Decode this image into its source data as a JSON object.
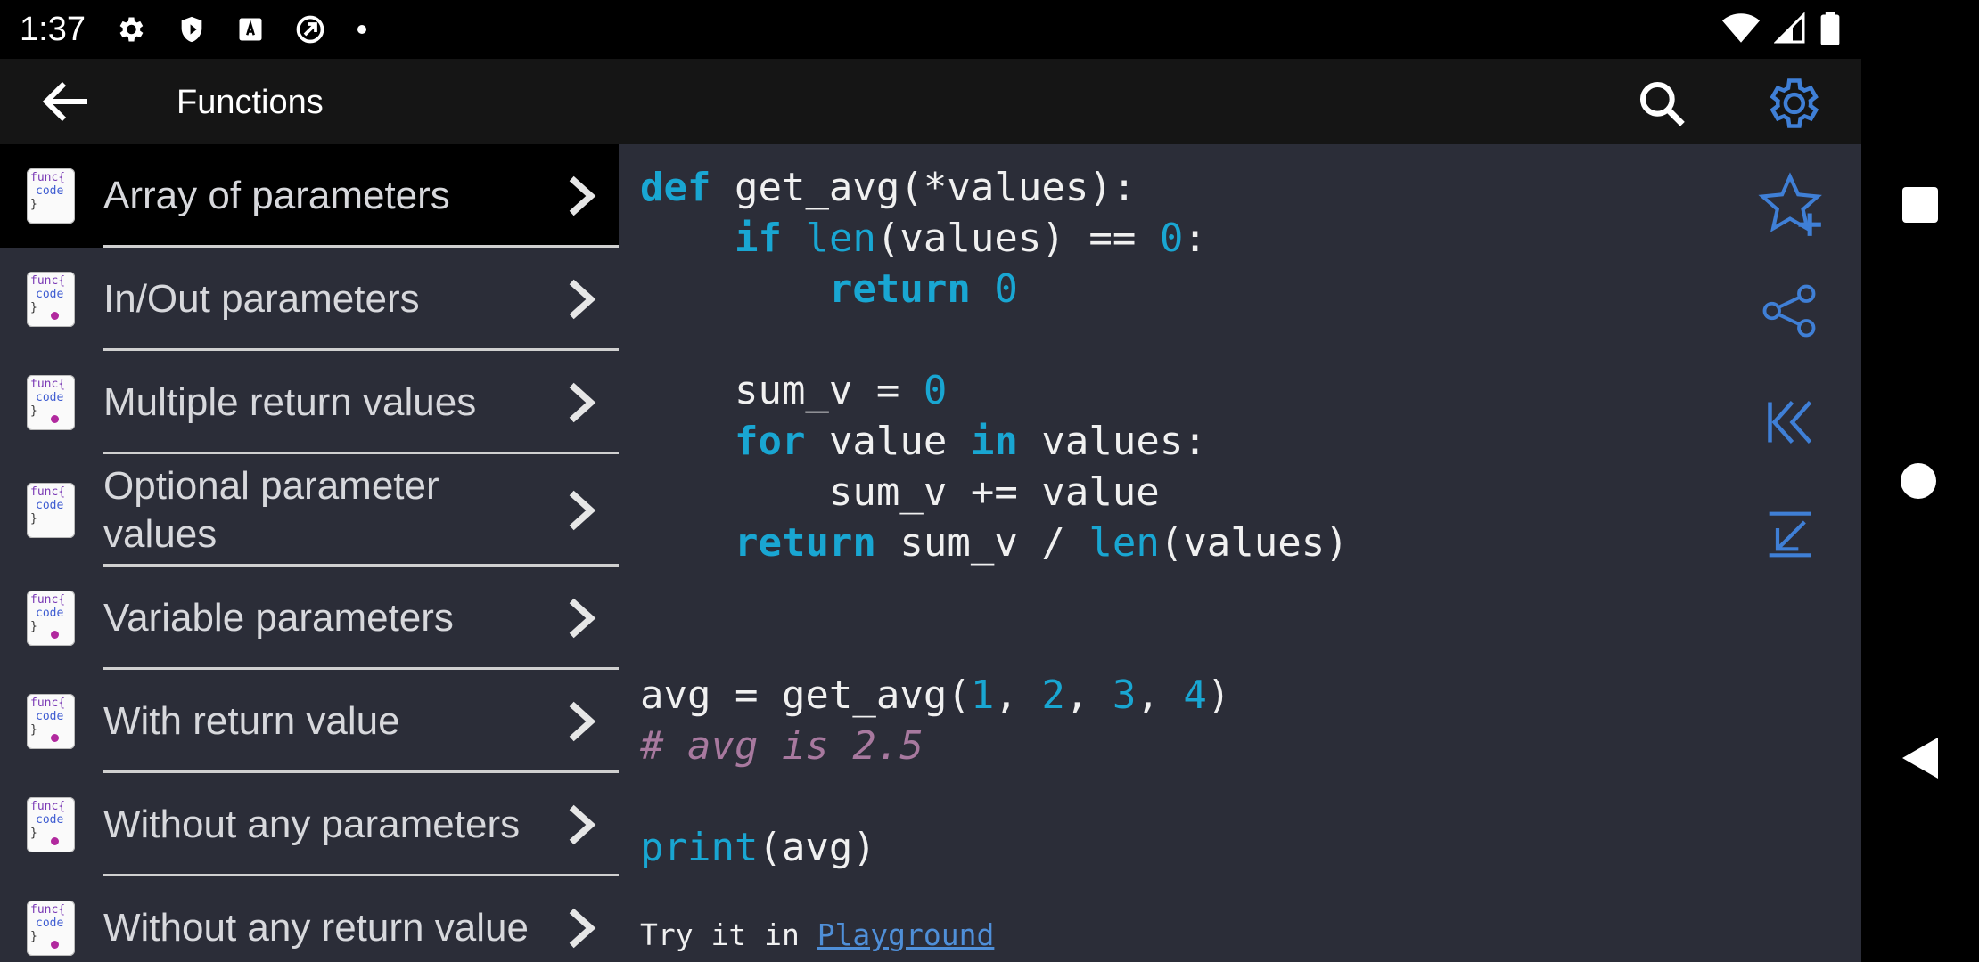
{
  "status": {
    "time": "1:37"
  },
  "appbar": {
    "title": "Functions"
  },
  "sidebar": {
    "items": [
      {
        "label": "Array of parameters",
        "active": true
      },
      {
        "label": "In/Out parameters"
      },
      {
        "label": "Multiple return values"
      },
      {
        "label": "Optional parameter values"
      },
      {
        "label": "Variable parameters"
      },
      {
        "label": "With return value"
      },
      {
        "label": "Without any parameters"
      },
      {
        "label": "Without any return value"
      }
    ],
    "thumb": {
      "line1": "func{",
      "line2": "code",
      "line3": "}"
    }
  },
  "code": {
    "lines": [
      "def get_avg(*values):",
      "    if len(values) == 0:",
      "        return 0",
      "",
      "    sum_v = 0",
      "    for value in values:",
      "        sum_v += value",
      "    return sum_v / len(values)",
      "",
      "",
      "avg = get_avg(1, 2, 3, 4)",
      "# avg is 2.5",
      "",
      "print(avg)"
    ]
  },
  "footer": {
    "try_text": "Try it in ",
    "link_text": "Playground"
  },
  "colors": {
    "keyword": "#19a6d2",
    "comment": "#a8799f",
    "link": "#4f8fd8",
    "panel": "#2b2d38",
    "icon_blue": "#3f7fd6"
  }
}
